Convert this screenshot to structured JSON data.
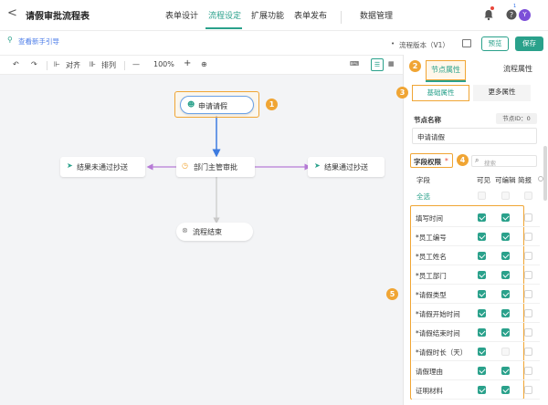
{
  "header": {
    "back_label": "<",
    "title": "请假审批流程表",
    "tabs": [
      {
        "label": "表单设计",
        "active": false
      },
      {
        "label": "流程设定",
        "active": true
      },
      {
        "label": "扩展功能",
        "active": false
      },
      {
        "label": "表单发布",
        "active": false
      }
    ],
    "data_manage": "数据管理",
    "help_badge": "1",
    "avatar": "Y"
  },
  "subbar": {
    "guide": "查看新手引导",
    "version": "流程版本（V1）",
    "preview": "预览",
    "save": "保存"
  },
  "toolbar": {
    "align": "对齐",
    "arrange": "排列",
    "zoom": "100%",
    "minus": "—",
    "plus": "+"
  },
  "canvas": {
    "nodes": {
      "apply": "申请请假",
      "approve": "部门主管审批",
      "cc_fail": "结果未通过抄送",
      "cc_pass": "结果通过抄送",
      "end": "流程结束"
    }
  },
  "panel": {
    "tab_node": "节点属性",
    "tab_flow": "流程属性",
    "sub_basic": "基础属性",
    "sub_more": "更多属性",
    "node_name_label": "节点名称",
    "node_id": "节点ID：0",
    "node_name_value": "申请请假",
    "perm_label": "字段权限",
    "perm_star": "*",
    "search_placeholder": "搜索",
    "col_field": "字段",
    "col_visible": "可见",
    "col_edit": "可编辑",
    "col_brief": "简报",
    "select_all": "全选",
    "fields": [
      {
        "name": "填写时间",
        "visible": true,
        "edit": true,
        "brief": false
      },
      {
        "name": "*员工编号",
        "visible": true,
        "edit": true,
        "brief": false
      },
      {
        "name": "*员工姓名",
        "visible": true,
        "edit": true,
        "brief": false
      },
      {
        "name": "*员工部门",
        "visible": true,
        "edit": true,
        "brief": false
      },
      {
        "name": "*请假类型",
        "visible": true,
        "edit": true,
        "brief": false
      },
      {
        "name": "*请假开始时间",
        "visible": true,
        "edit": true,
        "brief": false
      },
      {
        "name": "*请假结束时间",
        "visible": true,
        "edit": true,
        "brief": false
      },
      {
        "name": "*请假时长（天）",
        "visible": true,
        "edit": false,
        "brief": false
      },
      {
        "name": "请假理由",
        "visible": true,
        "edit": true,
        "brief": false
      },
      {
        "name": "证明材料",
        "visible": true,
        "edit": true,
        "brief": false
      }
    ]
  },
  "badges": [
    "1",
    "2",
    "3",
    "4",
    "5"
  ],
  "colors": {
    "accent": "#2aa18b",
    "highlight": "#f0a534",
    "link": "#4a7be8",
    "arrow_blue": "#3d7be0",
    "arrow_purple": "#b67ad6"
  }
}
